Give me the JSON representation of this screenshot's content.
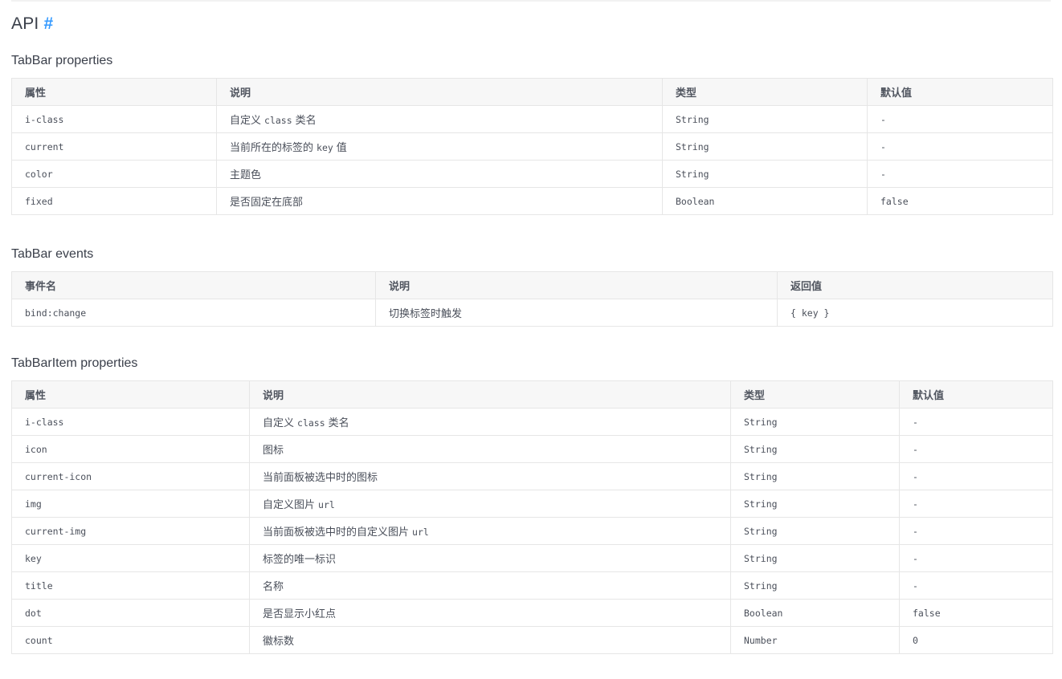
{
  "api": {
    "heading": "API",
    "anchor": "#"
  },
  "tabbar_props": {
    "title": "TabBar properties",
    "headers": [
      "属性",
      "说明",
      "类型",
      "默认值"
    ],
    "rows": [
      {
        "name": "i-class",
        "desc": "自定义",
        "desc_code": "class",
        "desc_after": "类名",
        "type": "String",
        "default": "-"
      },
      {
        "name": "current",
        "desc": "当前所在的标签的",
        "desc_code": "key",
        "desc_after": "值",
        "type": "String",
        "default": "-"
      },
      {
        "name": "color",
        "desc": "主题色",
        "desc_code": "",
        "desc_after": "",
        "type": "String",
        "default": "-"
      },
      {
        "name": "fixed",
        "desc": "是否固定在底部",
        "desc_code": "",
        "desc_after": "",
        "type": "Boolean",
        "default": "false"
      }
    ]
  },
  "tabbar_events": {
    "title": "TabBar events",
    "headers": [
      "事件名",
      "说明",
      "返回值"
    ],
    "rows": [
      {
        "name": "bind:change",
        "desc": "切换标签时触发",
        "returns": "{ key }"
      }
    ]
  },
  "tabbaritem_props": {
    "title": "TabBarItem properties",
    "headers": [
      "属性",
      "说明",
      "类型",
      "默认值"
    ],
    "rows": [
      {
        "name": "i-class",
        "desc": "自定义",
        "desc_code": "class",
        "desc_after": "类名",
        "type": "String",
        "default": "-"
      },
      {
        "name": "icon",
        "desc": "图标",
        "desc_code": "",
        "desc_after": "",
        "type": "String",
        "default": "-"
      },
      {
        "name": "current-icon",
        "desc": "当前面板被选中时的图标",
        "desc_code": "",
        "desc_after": "",
        "type": "String",
        "default": "-"
      },
      {
        "name": "img",
        "desc": "自定义图片",
        "desc_code": "url",
        "desc_after": "",
        "type": "String",
        "default": "-"
      },
      {
        "name": "current-img",
        "desc": "当前面板被选中时的自定义图片",
        "desc_code": "url",
        "desc_after": "",
        "type": "String",
        "default": "-"
      },
      {
        "name": "key",
        "desc": "标签的唯一标识",
        "desc_code": "",
        "desc_after": "",
        "type": "String",
        "default": "-"
      },
      {
        "name": "title",
        "desc": "名称",
        "desc_code": "",
        "desc_after": "",
        "type": "String",
        "default": "-"
      },
      {
        "name": "dot",
        "desc": "是否显示小红点",
        "desc_code": "",
        "desc_after": "",
        "type": "Boolean",
        "default": "false"
      },
      {
        "name": "count",
        "desc": "徽标数",
        "desc_code": "",
        "desc_after": "",
        "type": "Number",
        "default": "0"
      }
    ]
  }
}
